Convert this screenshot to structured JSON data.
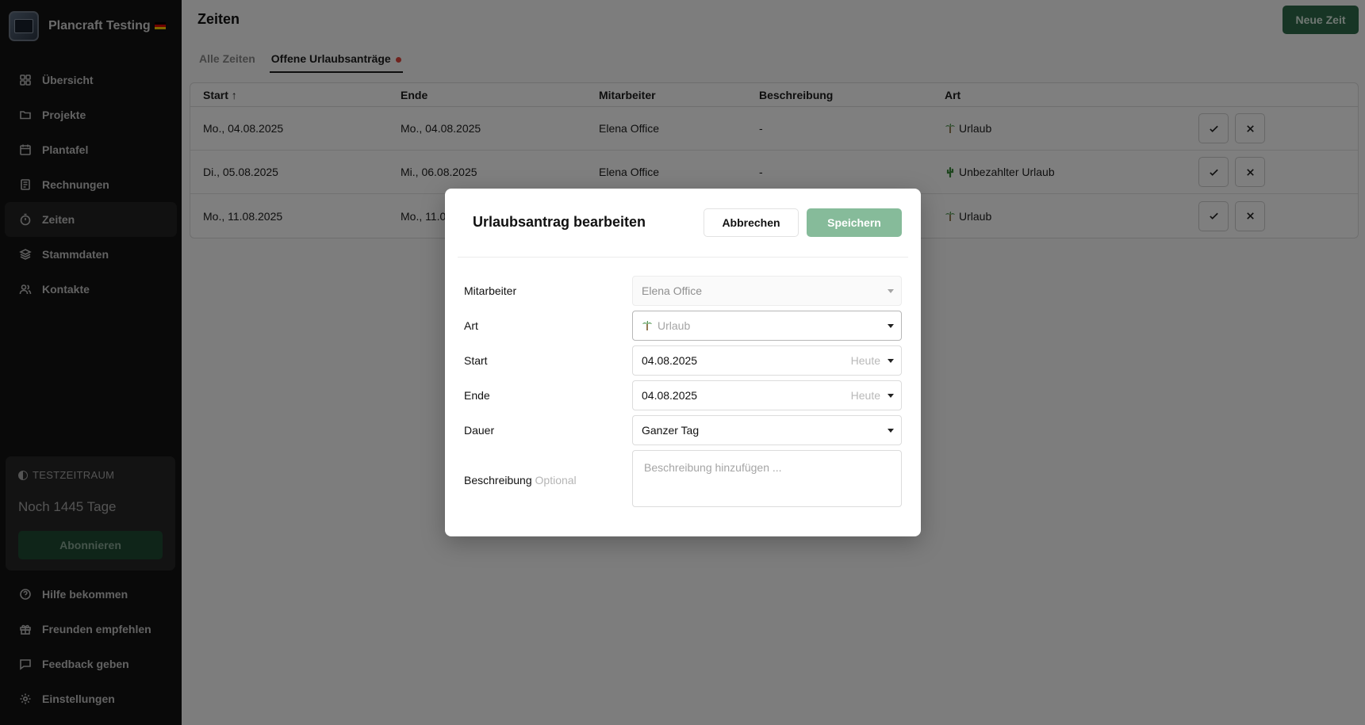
{
  "app": {
    "name": "Plancraft Testing"
  },
  "sidebar": {
    "items": [
      {
        "label": "Übersicht",
        "icon": "grid-icon"
      },
      {
        "label": "Projekte",
        "icon": "folder-icon"
      },
      {
        "label": "Plantafel",
        "icon": "calendar-icon"
      },
      {
        "label": "Rechnungen",
        "icon": "receipt-icon"
      },
      {
        "label": "Zeiten",
        "icon": "timer-icon",
        "active": true
      },
      {
        "label": "Stammdaten",
        "icon": "layers-icon"
      },
      {
        "label": "Kontakte",
        "icon": "users-icon"
      }
    ],
    "trial": {
      "label": "TESTZEITRAUM",
      "days": "Noch 1445 Tage",
      "subscribe": "Abonnieren"
    },
    "bottom_items": [
      {
        "label": "Hilfe bekommen",
        "icon": "help-icon"
      },
      {
        "label": "Freunden empfehlen",
        "icon": "gift-icon"
      },
      {
        "label": "Feedback geben",
        "icon": "message-icon"
      },
      {
        "label": "Einstellungen",
        "icon": "settings-icon"
      }
    ]
  },
  "header": {
    "title": "Zeiten",
    "new_button": "Neue Zeit"
  },
  "tabs": [
    {
      "label": "Alle Zeiten"
    },
    {
      "label": "Offene Urlaubsanträge",
      "active": true
    }
  ],
  "table": {
    "columns": [
      "Start",
      "Ende",
      "Mitarbeiter",
      "Beschreibung",
      "Art"
    ],
    "sort_icon": "arrow-up-icon",
    "rows": [
      {
        "start": "Mo., 04.08.2025",
        "ende": "Mo., 04.08.2025",
        "mitarbeiter": "Elena Office",
        "beschreibung": "-",
        "art": "Urlaub",
        "art_icon": "palm-tree-icon"
      },
      {
        "start": "Di., 05.08.2025",
        "ende": "Mi., 06.08.2025",
        "mitarbeiter": "Elena Office",
        "beschreibung": "-",
        "art": "Unbezahlter Urlaub",
        "art_icon": "cactus-icon"
      },
      {
        "start": "Mo., 11.08.2025",
        "ende": "Mo., 11.0",
        "mitarbeiter": "",
        "beschreibung": "",
        "art": "Urlaub",
        "art_icon": "palm-tree-icon"
      }
    ]
  },
  "modal": {
    "title": "Urlaubsantrag bearbeiten",
    "cancel": "Abbrechen",
    "save": "Speichern",
    "fields": {
      "mitarbeiter": {
        "label": "Mitarbeiter",
        "value": "Elena Office"
      },
      "art": {
        "label": "Art",
        "value": "Urlaub"
      },
      "start": {
        "label": "Start",
        "value": "04.08.2025",
        "hint": "Heute"
      },
      "ende": {
        "label": "Ende",
        "value": "04.08.2025",
        "hint": "Heute"
      },
      "dauer": {
        "label": "Dauer",
        "value": "Ganzer Tag"
      },
      "beschreibung": {
        "label": "Beschreibung",
        "optional": "Optional",
        "placeholder": "Beschreibung hinzufügen ..."
      }
    }
  },
  "colors": {
    "primary": "#2f6b4a",
    "save_disabled": "#86bb9a",
    "badge_dot": "#e0473c",
    "sidebar_bg": "#121212"
  }
}
